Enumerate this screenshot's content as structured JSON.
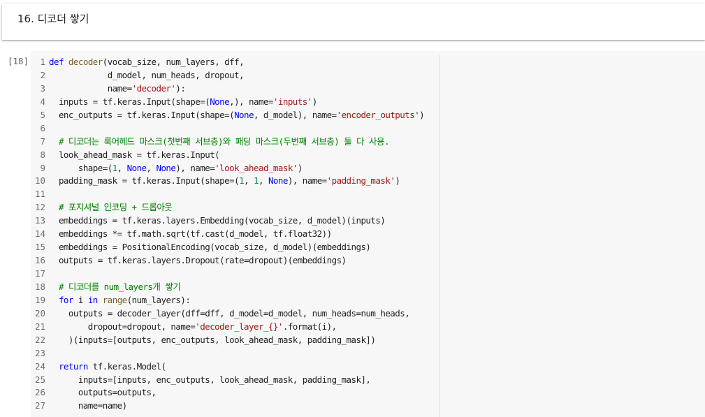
{
  "markdown": {
    "title": "16. 디코더 쌓기"
  },
  "code_cell": {
    "execution_count": "[18]",
    "lines": [
      [
        {
          "t": "def",
          "c": "kw"
        },
        {
          "t": " "
        },
        {
          "t": "decoder",
          "c": "fn"
        },
        {
          "t": "(vocab_size, num_layers, dff,"
        }
      ],
      [
        {
          "t": "            d_model, num_heads, dropout,"
        }
      ],
      [
        {
          "t": "            name="
        },
        {
          "t": "'decoder'",
          "c": "str"
        },
        {
          "t": "):"
        }
      ],
      [
        {
          "t": "  inputs = tf.keras.Input(shape=("
        },
        {
          "t": "None",
          "c": "kw"
        },
        {
          "t": ",), name="
        },
        {
          "t": "'inputs'",
          "c": "str"
        },
        {
          "t": ")"
        }
      ],
      [
        {
          "t": "  enc_outputs = tf.keras.Input(shape=("
        },
        {
          "t": "None",
          "c": "kw"
        },
        {
          "t": ", d_model), name="
        },
        {
          "t": "'encoder_outputs'",
          "c": "str"
        },
        {
          "t": ")"
        }
      ],
      [
        {
          "t": ""
        }
      ],
      [
        {
          "t": "  "
        },
        {
          "t": "# 디코더는 룩어헤드 마스크(첫번째 서브층)와 패딩 마스크(두번째 서브층) 둘 다 사용.",
          "c": "cmt"
        }
      ],
      [
        {
          "t": "  look_ahead_mask = tf.keras.Input("
        }
      ],
      [
        {
          "t": "      shape=("
        },
        {
          "t": "1",
          "c": "num"
        },
        {
          "t": ", "
        },
        {
          "t": "None",
          "c": "kw"
        },
        {
          "t": ", "
        },
        {
          "t": "None",
          "c": "kw"
        },
        {
          "t": "), name="
        },
        {
          "t": "'look_ahead_mask'",
          "c": "str"
        },
        {
          "t": ")"
        }
      ],
      [
        {
          "t": "  padding_mask = tf.keras.Input(shape=("
        },
        {
          "t": "1",
          "c": "num"
        },
        {
          "t": ", "
        },
        {
          "t": "1",
          "c": "num"
        },
        {
          "t": ", "
        },
        {
          "t": "None",
          "c": "kw"
        },
        {
          "t": "), name="
        },
        {
          "t": "'padding_mask'",
          "c": "str"
        },
        {
          "t": ")"
        }
      ],
      [
        {
          "t": ""
        }
      ],
      [
        {
          "t": "  "
        },
        {
          "t": "# 포지셔널 인코딩 + 드롭아웃",
          "c": "cmt"
        }
      ],
      [
        {
          "t": "  embeddings = tf.keras.layers.Embedding(vocab_size, d_model)(inputs)"
        }
      ],
      [
        {
          "t": "  embeddings *= tf.math.sqrt(tf.cast(d_model, tf.float32))"
        }
      ],
      [
        {
          "t": "  embeddings = PositionalEncoding(vocab_size, d_model)(embeddings)"
        }
      ],
      [
        {
          "t": "  outputs = tf.keras.layers.Dropout(rate=dropout)(embeddings)"
        }
      ],
      [
        {
          "t": ""
        }
      ],
      [
        {
          "t": "  "
        },
        {
          "t": "# 디코더를 num_layers개 쌓기",
          "c": "cmt"
        }
      ],
      [
        {
          "t": "  "
        },
        {
          "t": "for",
          "c": "kw"
        },
        {
          "t": " i "
        },
        {
          "t": "in",
          "c": "kw"
        },
        {
          "t": " "
        },
        {
          "t": "range",
          "c": "fn"
        },
        {
          "t": "(num_layers):"
        }
      ],
      [
        {
          "t": "    outputs = decoder_layer(dff=dff, d_model=d_model, num_heads=num_heads,"
        }
      ],
      [
        {
          "t": "        dropout=dropout, name="
        },
        {
          "t": "'decoder_layer_{}'",
          "c": "str"
        },
        {
          "t": ".format(i),"
        }
      ],
      [
        {
          "t": "    )(inputs=[outputs, enc_outputs, look_ahead_mask, padding_mask])"
        }
      ],
      [
        {
          "t": ""
        }
      ],
      [
        {
          "t": "  "
        },
        {
          "t": "return",
          "c": "kw"
        },
        {
          "t": " tf.keras.Model("
        }
      ],
      [
        {
          "t": "      inputs=[inputs, enc_outputs, look_ahead_mask, padding_mask],"
        }
      ],
      [
        {
          "t": "      outputs=outputs,"
        }
      ],
      [
        {
          "t": "      name=name)"
        }
      ]
    ]
  }
}
